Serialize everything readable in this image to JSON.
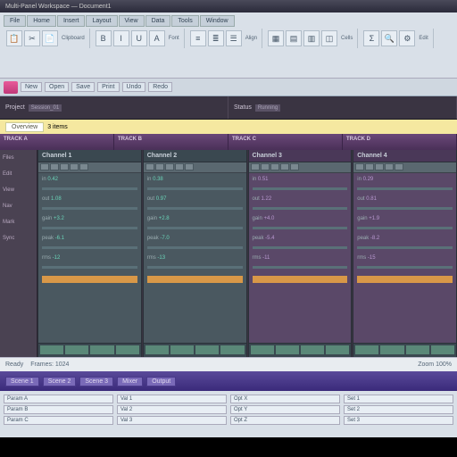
{
  "title": "Multi-Panel Workspace — Document1",
  "ribbon": {
    "tabs": [
      "File",
      "Home",
      "Insert",
      "Layout",
      "View",
      "Data",
      "Tools",
      "Window"
    ],
    "groups": [
      {
        "label": "Clipboard",
        "buttons": [
          "📋",
          "✂",
          "📄"
        ]
      },
      {
        "label": "Font",
        "buttons": [
          "B",
          "I",
          "U",
          "A"
        ]
      },
      {
        "label": "Align",
        "buttons": [
          "≡",
          "≣",
          "☰"
        ]
      },
      {
        "label": "Cells",
        "buttons": [
          "▦",
          "▤",
          "▥",
          "◫"
        ]
      },
      {
        "label": "Edit",
        "buttons": [
          "Σ",
          "🔍",
          "⚙"
        ]
      }
    ]
  },
  "toolbar2": [
    "New",
    "Open",
    "Save",
    "Print",
    "Undo",
    "Redo"
  ],
  "dark_header": {
    "left": {
      "label": "Project",
      "field": "Session_01"
    },
    "right": {
      "label": "Status",
      "field": "Running"
    }
  },
  "yellow": {
    "tab": "Overview",
    "text": "3 items"
  },
  "purple_strip": [
    "TRACK A",
    "TRACK B",
    "TRACK C",
    "TRACK D"
  ],
  "sidebar": [
    "Files",
    "Edit",
    "View",
    "Nav",
    "Mark",
    "Sync"
  ],
  "panels": [
    {
      "title": "Channel 1",
      "rows": [
        {
          "l": "in",
          "v": "0.42"
        },
        {
          "l": "out",
          "v": "1.08"
        },
        {
          "l": "gain",
          "v": "+3.2"
        },
        {
          "l": "peak",
          "v": "-6.1"
        },
        {
          "l": "rms",
          "v": "-12"
        }
      ]
    },
    {
      "title": "Channel 2",
      "rows": [
        {
          "l": "in",
          "v": "0.38"
        },
        {
          "l": "out",
          "v": "0.97"
        },
        {
          "l": "gain",
          "v": "+2.8"
        },
        {
          "l": "peak",
          "v": "-7.0"
        },
        {
          "l": "rms",
          "v": "-13"
        }
      ]
    },
    {
      "title": "Channel 3",
      "rows": [
        {
          "l": "in",
          "v": "0.51"
        },
        {
          "l": "out",
          "v": "1.22"
        },
        {
          "l": "gain",
          "v": "+4.0"
        },
        {
          "l": "peak",
          "v": "-5.4"
        },
        {
          "l": "rms",
          "v": "-11"
        }
      ],
      "purple": true
    },
    {
      "title": "Channel 4",
      "rows": [
        {
          "l": "in",
          "v": "0.29"
        },
        {
          "l": "out",
          "v": "0.81"
        },
        {
          "l": "gain",
          "v": "+1.9"
        },
        {
          "l": "peak",
          "v": "-8.2"
        },
        {
          "l": "rms",
          "v": "-15"
        }
      ],
      "purple": true
    }
  ],
  "status": {
    "left": "Ready",
    "mid": "Frames: 1024",
    "right": "Zoom 100%"
  },
  "bottom_tabs": [
    "Scene 1",
    "Scene 2",
    "Scene 3",
    "Mixer",
    "Output"
  ],
  "footer": {
    "cols": [
      [
        "Param A",
        "Param B",
        "Param C"
      ],
      [
        "Val 1",
        "Val 2",
        "Val 3"
      ],
      [
        "Opt X",
        "Opt Y",
        "Opt Z"
      ],
      [
        "Set 1",
        "Set 2",
        "Set 3"
      ]
    ]
  }
}
